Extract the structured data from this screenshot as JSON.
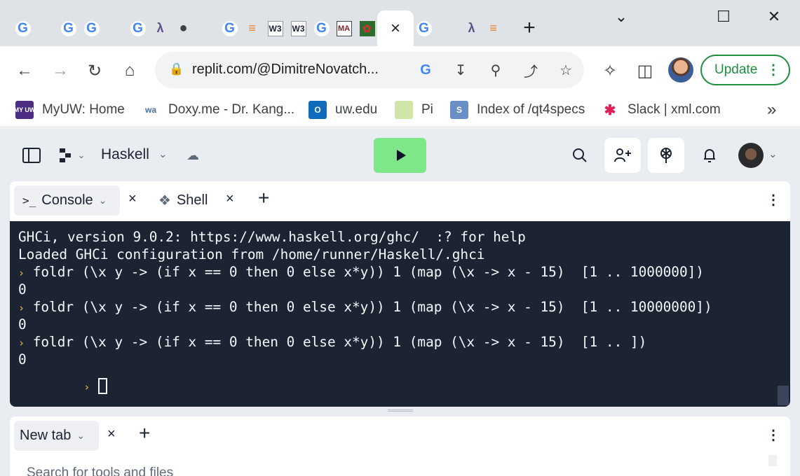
{
  "browser": {
    "tabs": [
      {
        "icon": "google-icon",
        "glyph": "G"
      },
      {
        "icon": "microsoft-icon",
        "glyph": ""
      },
      {
        "icon": "google-icon",
        "glyph": "G"
      },
      {
        "icon": "google-icon",
        "glyph": "G"
      },
      {
        "icon": "microsoft-icon",
        "glyph": ""
      },
      {
        "icon": "google-icon",
        "glyph": "G"
      },
      {
        "icon": "haskell-icon",
        "glyph": "λ"
      },
      {
        "icon": "globe-icon",
        "glyph": "●"
      },
      {
        "icon": "microsoft-icon",
        "glyph": ""
      },
      {
        "icon": "google-icon",
        "glyph": "G"
      },
      {
        "icon": "stackoverflow-icon",
        "glyph": "≡"
      },
      {
        "icon": "w3schools-icon",
        "glyph": "W3"
      },
      {
        "icon": "w3schools-icon",
        "glyph": "W3"
      },
      {
        "icon": "google-icon",
        "glyph": "G"
      },
      {
        "icon": "math-icon",
        "glyph": "MA"
      },
      {
        "icon": "photo-icon",
        "glyph": "✿"
      }
    ],
    "active_tab_close": "×",
    "tabs_after": [
      {
        "icon": "google-icon",
        "glyph": "G"
      },
      {
        "icon": "haskell-icon",
        "glyph": "λ"
      },
      {
        "icon": "stackoverflow-icon",
        "glyph": "≡"
      }
    ],
    "new_tab": "+",
    "window": {
      "minimize": "⌄",
      "maximize": "☐",
      "close": "✕"
    },
    "url": "replit.com/@DimitreNovatch...",
    "update_label": "Update",
    "bookmarks": [
      {
        "label": "MyUW: Home",
        "icon": "myuw-icon",
        "glyph": "MY UW",
        "color": "#4b2e83"
      },
      {
        "label": "Doxy.me - Dr. Kang...",
        "icon": "doxy-icon",
        "glyph": "wa",
        "color": "#ffffff"
      },
      {
        "label": "uw.edu",
        "icon": "outlook-icon",
        "glyph": "O",
        "color": "#0f6cbd"
      },
      {
        "label": "Pi",
        "icon": "pi-icon",
        "glyph": "",
        "color": "#cfe6a8"
      },
      {
        "label": "Index of /qt4specs",
        "icon": "s-icon",
        "glyph": "S",
        "color": "#6a8fc7"
      },
      {
        "label": "Slack | xml.com",
        "icon": "slack-icon",
        "glyph": "✱",
        "color": "#ffffff"
      }
    ],
    "bookmarks_more": "»"
  },
  "replit": {
    "language": "Haskell",
    "panes": {
      "console_tab": "Console",
      "shell_tab": "Shell",
      "new_tab_label": "New tab"
    },
    "console_lines": [
      {
        "prompt": "",
        "text": "GHCi, version 9.0.2: https://www.haskell.org/ghc/  :? for help"
      },
      {
        "prompt": "",
        "text": "Loaded GHCi configuration from /home/runner/Haskell/.ghci"
      },
      {
        "prompt": "›",
        "text": " foldr (\\x y -> (if x == 0 then 0 else x*y)) 1 (map (\\x -> x - 15)  [1 .. 1000000])"
      },
      {
        "prompt": "",
        "text": "0"
      },
      {
        "prompt": "›",
        "text": " foldr (\\x y -> (if x == 0 then 0 else x*y)) 1 (map (\\x -> x - 15)  [1 .. 10000000])"
      },
      {
        "prompt": "",
        "text": "0"
      },
      {
        "prompt": "›",
        "text": " foldr (\\x y -> (if x == 0 then 0 else x*y)) 1 (map (\\x -> x - 15)  [1 .. ])"
      },
      {
        "prompt": "",
        "text": "0"
      }
    ],
    "input_prompt": "›",
    "search_placeholder": "Search for tools and files"
  },
  "colors": {
    "run_button": "#7ee787",
    "console_bg": "#1c2333",
    "prompt": "#f0c02a",
    "update_green": "#1e8e3e"
  }
}
